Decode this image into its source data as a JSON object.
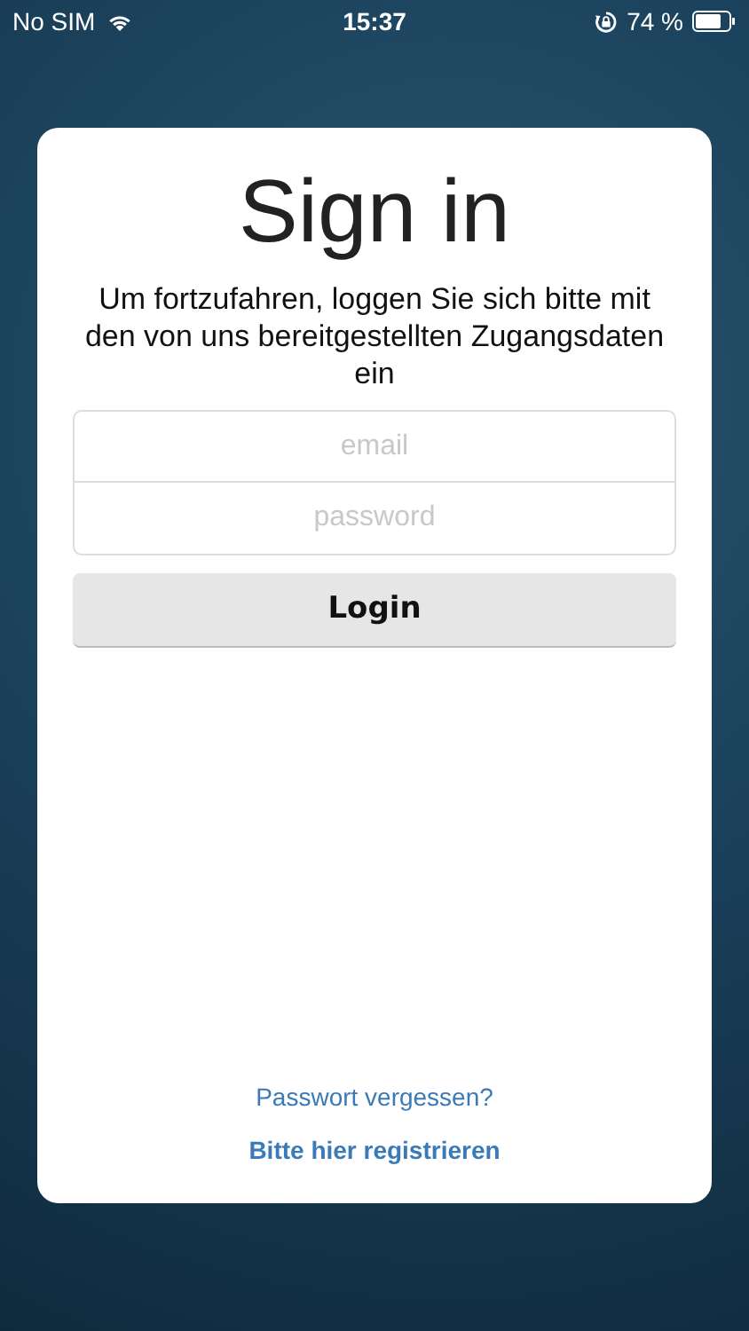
{
  "status_bar": {
    "carrier": "No SIM",
    "time": "15:37",
    "battery": "74 %"
  },
  "sign_in": {
    "title": "Sign in",
    "subtitle": "Um fortzufahren, loggen Sie sich bitte mit den von uns bereitgestellten Zugangsdaten ein",
    "fields": [
      {
        "placeholder": "email"
      },
      {
        "placeholder": "password"
      }
    ],
    "button": "Login",
    "links": [
      {
        "label": "Passwort vergessen?",
        "bold": false
      },
      {
        "label": "Bitte hier registrieren",
        "bold": true
      }
    ]
  }
}
